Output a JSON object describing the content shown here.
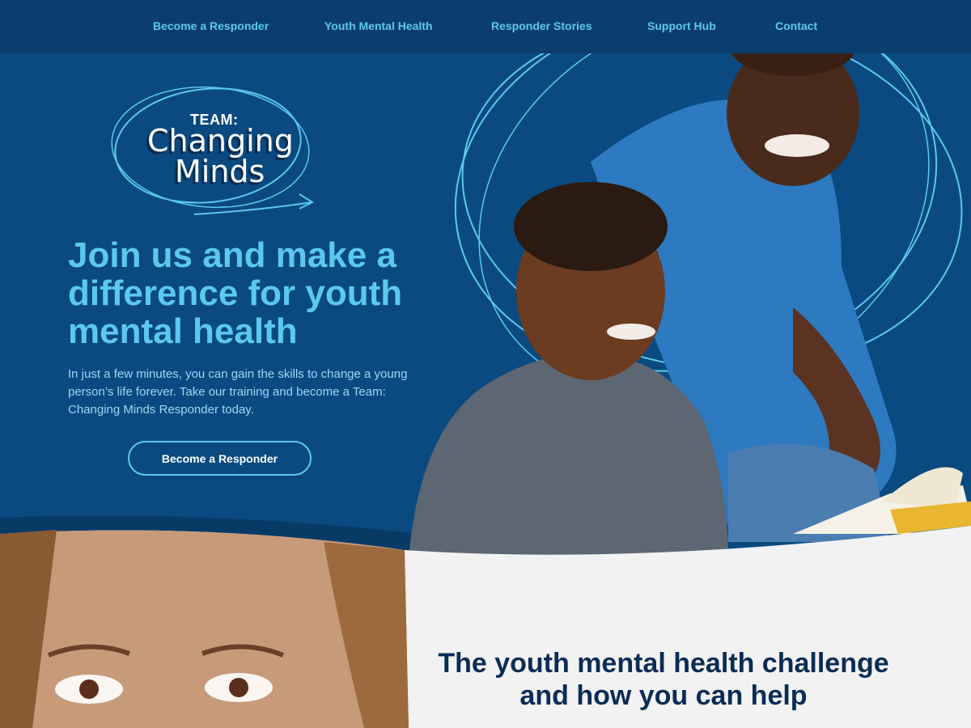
{
  "nav": {
    "items": [
      {
        "label": "Become a Responder"
      },
      {
        "label": "Youth Mental Health"
      },
      {
        "label": "Responder Stories"
      },
      {
        "label": "Support Hub"
      },
      {
        "label": "Contact"
      }
    ]
  },
  "logo": {
    "team": "TEAM:",
    "line1": "Changing",
    "line2": "Minds"
  },
  "hero": {
    "headline": "Join us and make a difference for youth mental health",
    "subcopy": "In just a few minutes, you can gain the skills to change a young person’s life forever. Take our training and become a Team: Changing Minds Responder today.",
    "cta_label": "Become a Responder"
  },
  "section": {
    "title": "The youth mental health challenge and how you can help"
  },
  "colors": {
    "hero_bg": "#0a4a80",
    "nav_bg": "#0b3e6e",
    "accent": "#5cc8f0",
    "dark_navy": "#0b2c55",
    "light_bg": "#f2f2f2"
  }
}
